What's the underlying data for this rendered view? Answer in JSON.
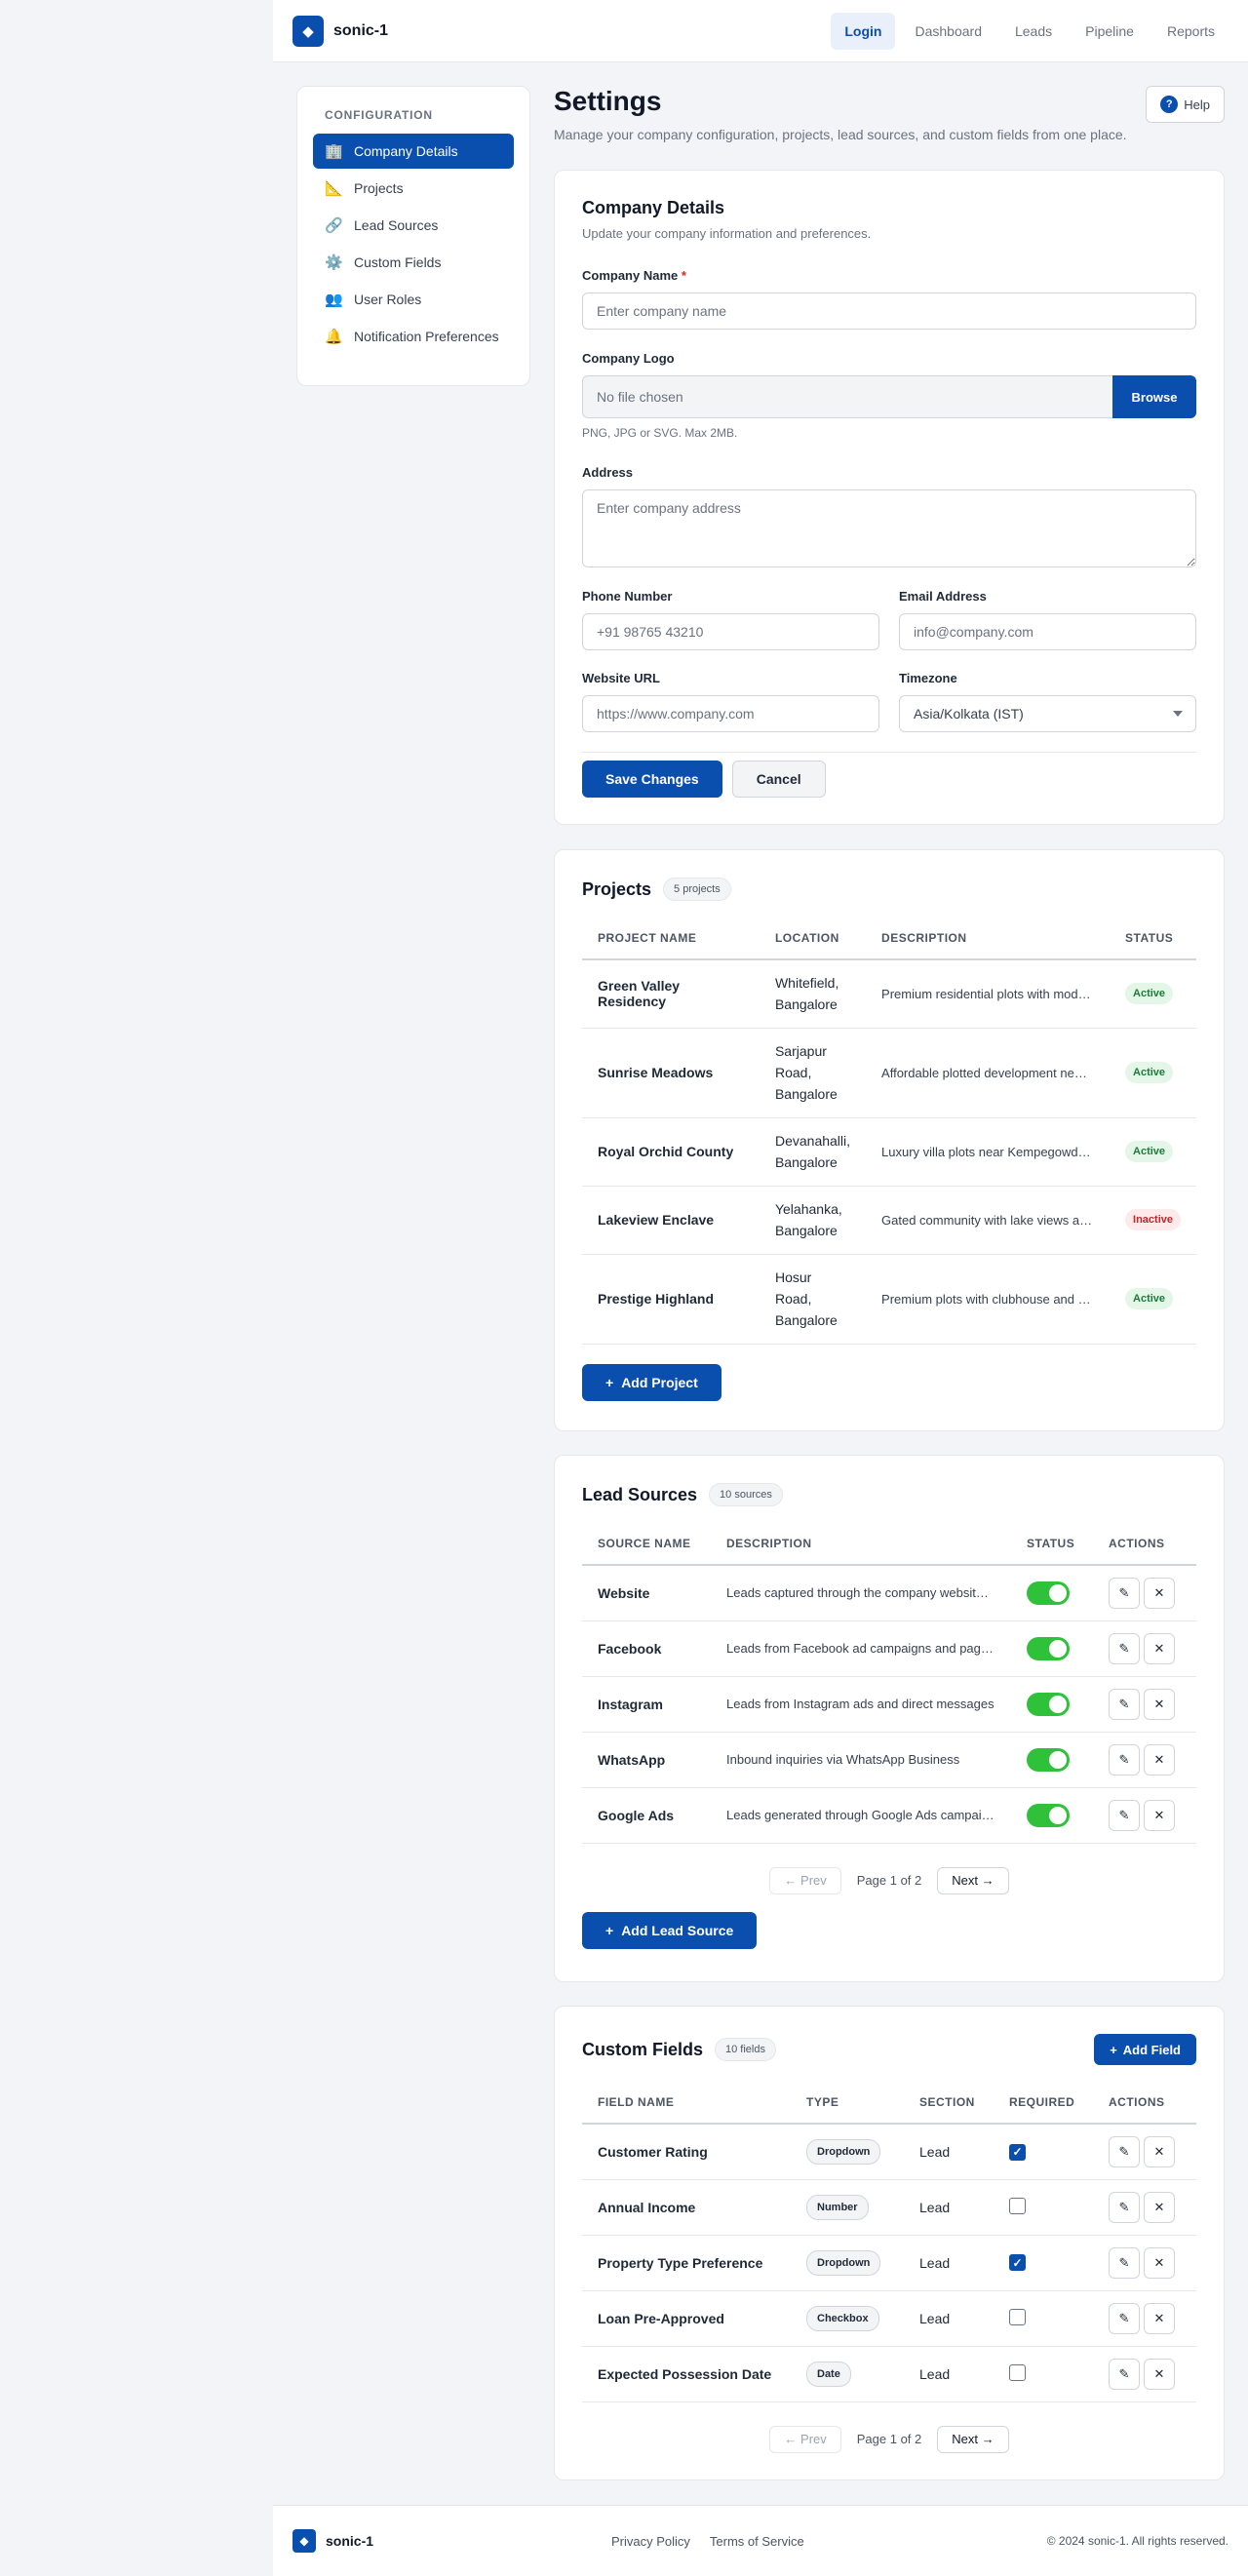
{
  "brand": {
    "name": "sonic-1",
    "logo_glyph": "◆"
  },
  "nav": [
    {
      "label": "Login",
      "active": true
    },
    {
      "label": "Dashboard"
    },
    {
      "label": "Leads"
    },
    {
      "label": "Pipeline"
    },
    {
      "label": "Reports"
    }
  ],
  "sidebar": {
    "heading": "CONFIGURATION",
    "items": [
      {
        "label": "Company Details",
        "icon": "🏢",
        "active": true
      },
      {
        "label": "Projects",
        "icon": "📐"
      },
      {
        "label": "Lead Sources",
        "icon": "🔗"
      },
      {
        "label": "Custom Fields",
        "icon": "⚙️"
      },
      {
        "label": "User Roles",
        "icon": "👥"
      },
      {
        "label": "Notification Preferences",
        "icon": "🔔"
      }
    ]
  },
  "page": {
    "title": "Settings",
    "subtitle": "Manage your company configuration, projects, lead sources, and custom fields from one place.",
    "help_label": "Help",
    "help_glyph": "?"
  },
  "company": {
    "title": "Company Details",
    "subtitle": "Update your company information and preferences.",
    "name_label": "Company Name",
    "required_mark": "*",
    "name_placeholder": "Enter company name",
    "logo_label": "Company Logo",
    "logo_value": "No file chosen",
    "browse_label": "Browse",
    "logo_hint": "PNG, JPG or SVG. Max 2MB.",
    "address_label": "Address",
    "address_placeholder": "Enter company address",
    "phone_label": "Phone Number",
    "phone_placeholder": "+91 98765 43210",
    "email_label": "Email Address",
    "email_placeholder": "info@company.com",
    "website_label": "Website URL",
    "website_placeholder": "https://www.company.com",
    "timezone_label": "Timezone",
    "timezone_value": "Asia/Kolkata (IST)",
    "save_label": "Save Changes",
    "cancel_label": "Cancel"
  },
  "projects": {
    "title": "Projects",
    "count": "5 projects",
    "columns": [
      "PROJECT NAME",
      "LOCATION",
      "DESCRIPTION",
      "STATUS"
    ],
    "rows": [
      {
        "name": "Green Valley Residency",
        "location": "Whitefield, Bangalore",
        "description": "Premium residential plots with modern amenities",
        "status": "Active"
      },
      {
        "name": "Sunrise Meadows",
        "location": "Sarjapur Road, Bangalore",
        "description": "Affordable plotted development near IT corridor",
        "status": "Active"
      },
      {
        "name": "Royal Orchid County",
        "location": "Devanahalli, Bangalore",
        "description": "Luxury villa plots near Kempegowda Airport",
        "status": "Active"
      },
      {
        "name": "Lakeview Enclave",
        "location": "Yelahanka, Bangalore",
        "description": "Gated community with lake views and parks",
        "status": "Inactive"
      },
      {
        "name": "Prestige Highland",
        "location": "Hosur Road, Bangalore",
        "description": "Premium plots with clubhouse and sports facilities",
        "status": "Active"
      }
    ],
    "add_label": "Add Project"
  },
  "lead_sources": {
    "title": "Lead Sources",
    "count": "10 sources",
    "columns": [
      "SOURCE NAME",
      "DESCRIPTION",
      "STATUS",
      "ACTIONS"
    ],
    "rows": [
      {
        "name": "Website",
        "description": "Leads captured through the company website forms",
        "enabled": true
      },
      {
        "name": "Facebook",
        "description": "Leads from Facebook ad campaigns and page messages",
        "enabled": true
      },
      {
        "name": "Instagram",
        "description": "Leads from Instagram ads and direct messages",
        "enabled": true
      },
      {
        "name": "WhatsApp",
        "description": "Inbound inquiries via WhatsApp Business",
        "enabled": true
      },
      {
        "name": "Google Ads",
        "description": "Leads generated through Google Ads campaigns",
        "enabled": true
      }
    ],
    "pager": {
      "prev": "← Prev",
      "text": "Page 1 of 2",
      "next": "Next →"
    },
    "add_label": "Add Lead Source"
  },
  "custom_fields": {
    "title": "Custom Fields",
    "count": "10 fields",
    "add_label": "Add Field",
    "columns": [
      "FIELD NAME",
      "TYPE",
      "SECTION",
      "REQUIRED",
      "ACTIONS"
    ],
    "rows": [
      {
        "name": "Customer Rating",
        "type": "Dropdown",
        "section": "Lead",
        "required": true
      },
      {
        "name": "Annual Income",
        "type": "Number",
        "section": "Lead",
        "required": false
      },
      {
        "name": "Property Type Preference",
        "type": "Dropdown",
        "section": "Lead",
        "required": true
      },
      {
        "name": "Loan Pre-Approved",
        "type": "Checkbox",
        "section": "Lead",
        "required": false
      },
      {
        "name": "Expected Possession Date",
        "type": "Date",
        "section": "Lead",
        "required": false
      }
    ],
    "pager": {
      "prev": "← Prev",
      "text": "Page 1 of 2",
      "next": "Next →"
    }
  },
  "icons": {
    "plus": "+",
    "edit": "✎",
    "delete": "✕",
    "check": "✓"
  },
  "footer": {
    "brand": "sonic-1",
    "links": [
      "Privacy Policy",
      "Terms of Service"
    ],
    "copyright": "© 2024 sonic-1. All rights reserved."
  },
  "colors": {
    "primary": "#0b4fae",
    "toggle_on": "#2fc139",
    "active_bg": "#e3f6e8",
    "inactive_bg": "#fdeaea"
  }
}
